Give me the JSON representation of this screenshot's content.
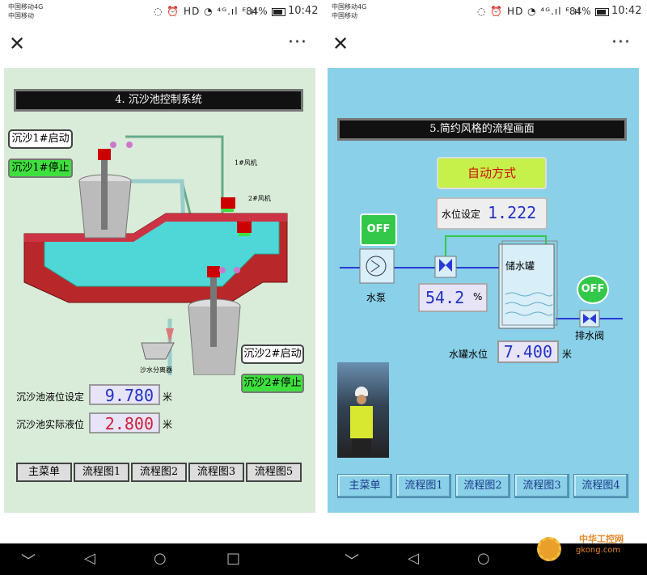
{
  "status_left": {
    "carrier1": "中国移动4G",
    "carrier2": "中国移动",
    "icons": "◌ ⏰ HD ◔ ⁴ᴳ.ıl ᴱ.ıl",
    "battery": "84%",
    "time": "10:42"
  },
  "status_right": {
    "carrier1": "中国移动4G",
    "carrier2": "中国移动",
    "icons": "◌ ⏰ HD ◔ ⁴ᴳ.ıl ᴱ.ıl",
    "battery": "84%",
    "time": "10:42"
  },
  "topbar": {
    "close_glyph": "✕",
    "more_glyph": "···"
  },
  "left": {
    "title": "4. 沉沙池控制系统",
    "btn_start1": "沉沙1#启动",
    "btn_stop1": "沉沙1#停止",
    "btn_start2": "沉沙2#启动",
    "btn_stop2": "沉沙2#停止",
    "fan1": "1#风机",
    "fan2": "2#风机",
    "separator": "沙水分离器",
    "level_set_label": "沉沙池液位设定",
    "level_set_value": "9.780",
    "level_set_unit": "米",
    "level_act_label": "沉沙池实际液位",
    "level_act_value": "2.800",
    "level_act_unit": "米",
    "nav": [
      "主菜单",
      "流程图1",
      "流程图2",
      "流程图3",
      "流程图5"
    ],
    "colors": {
      "water": "#4fd6d6",
      "brick": "#b8282a",
      "green": "#3ee03e"
    }
  },
  "right": {
    "title": "5.简约风格的流程画面",
    "auto_mode": "自动方式",
    "level_set_label": "水位设定",
    "level_set_value": "1.222",
    "off_pump": "OFF",
    "off_valve": "OFF",
    "pump_label": "水泵",
    "tank_label": "储水罐",
    "valve_label": "排水阀",
    "valve_open": "54.2",
    "valve_open_unit": "%",
    "tank_level_label": "水罐水位",
    "tank_level_value": "7.400",
    "tank_level_unit": "米",
    "nav": [
      "主菜单",
      "流程图1",
      "流程图2",
      "流程图3",
      "流程图4"
    ],
    "colors": {
      "bg": "#8ad0e8",
      "auto": "#c6f04a",
      "pipe": "#2a3ad8",
      "green": "#34c84a"
    }
  },
  "sysnav": {
    "back": "﹀",
    "tri": "◁",
    "home": "○",
    "recent": "□"
  },
  "watermark": {
    "cn": "中华工控网",
    "url": "gkong.com"
  }
}
